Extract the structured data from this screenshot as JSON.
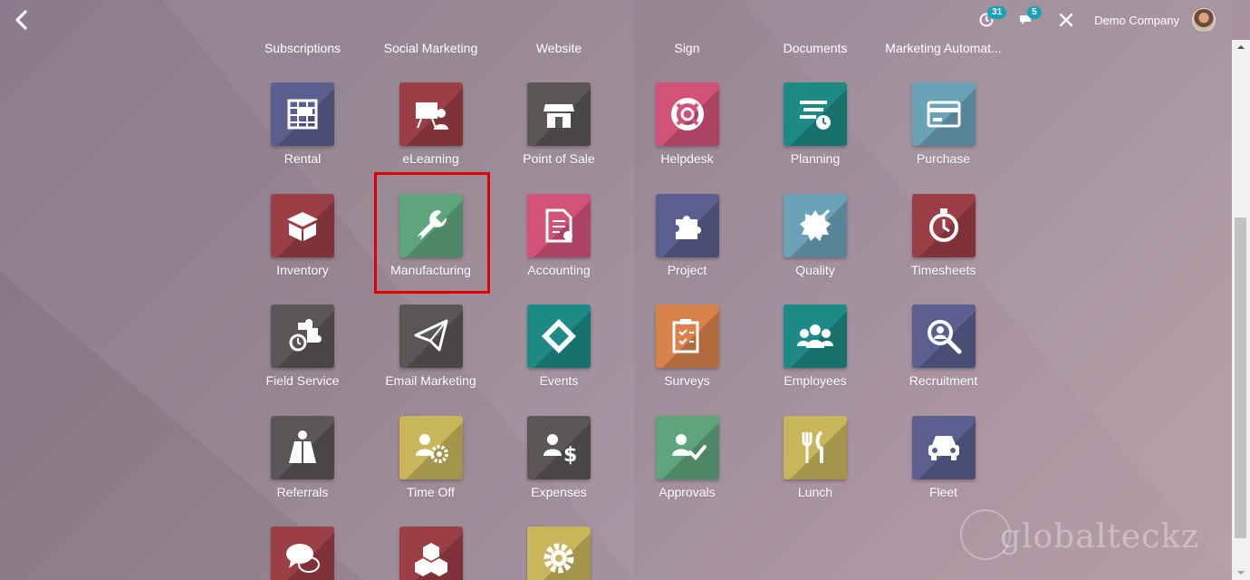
{
  "topbar": {
    "activity_count": "31",
    "messages_count": "5",
    "company_name": "Demo Company"
  },
  "top_row": [
    {
      "label": "Subscriptions"
    },
    {
      "label": "Social Marketing"
    },
    {
      "label": "Website"
    },
    {
      "label": "Sign"
    },
    {
      "label": "Documents"
    },
    {
      "label": "Marketing Automat..."
    }
  ],
  "apps": [
    {
      "label": "Rental",
      "color": "#5a5f8f",
      "icon": "rental-icon"
    },
    {
      "label": "eLearning",
      "color": "#9b3e45",
      "icon": "elearning-icon"
    },
    {
      "label": "Point of Sale",
      "color": "#5a5656",
      "icon": "point-of-sale-icon"
    },
    {
      "label": "Helpdesk",
      "color": "#d2527a",
      "icon": "helpdesk-icon"
    },
    {
      "label": "Planning",
      "color": "#1e8a86",
      "icon": "planning-icon"
    },
    {
      "label": "Purchase",
      "color": "#6aa2b8",
      "icon": "purchase-icon"
    },
    {
      "label": "Inventory",
      "color": "#9b3e45",
      "icon": "inventory-icon"
    },
    {
      "label": "Manufacturing",
      "color": "#5fa57b",
      "icon": "manufacturing-icon"
    },
    {
      "label": "Accounting",
      "color": "#d2527a",
      "icon": "accounting-icon"
    },
    {
      "label": "Project",
      "color": "#5a5f8f",
      "icon": "project-icon"
    },
    {
      "label": "Quality",
      "color": "#6aa2b8",
      "icon": "quality-icon"
    },
    {
      "label": "Timesheets",
      "color": "#9b3e45",
      "icon": "timesheets-icon"
    },
    {
      "label": "Field Service",
      "color": "#5a5656",
      "icon": "field-service-icon"
    },
    {
      "label": "Email Marketing",
      "color": "#5a5656",
      "icon": "email-marketing-icon"
    },
    {
      "label": "Events",
      "color": "#1e8a86",
      "icon": "events-icon"
    },
    {
      "label": "Surveys",
      "color": "#d9824b",
      "icon": "surveys-icon"
    },
    {
      "label": "Employees",
      "color": "#1e8a86",
      "icon": "employees-icon"
    },
    {
      "label": "Recruitment",
      "color": "#5a5f8f",
      "icon": "recruitment-icon"
    },
    {
      "label": "Referrals",
      "color": "#5a5656",
      "icon": "referrals-icon"
    },
    {
      "label": "Time Off",
      "color": "#c9b65b",
      "icon": "time-off-icon"
    },
    {
      "label": "Expenses",
      "color": "#5a5656",
      "icon": "expenses-icon"
    },
    {
      "label": "Approvals",
      "color": "#5fa57b",
      "icon": "approvals-icon"
    },
    {
      "label": "Lunch",
      "color": "#c9b65b",
      "icon": "lunch-icon"
    },
    {
      "label": "Fleet",
      "color": "#5a5f8f",
      "icon": "fleet-icon"
    },
    {
      "label": "",
      "color": "#9b3e45",
      "icon": "discuss-icon"
    },
    {
      "label": "",
      "color": "#9b3e45",
      "icon": "apps-icon"
    },
    {
      "label": "",
      "color": "#c9b65b",
      "icon": "settings-icon"
    }
  ],
  "watermark": "globalteckz"
}
